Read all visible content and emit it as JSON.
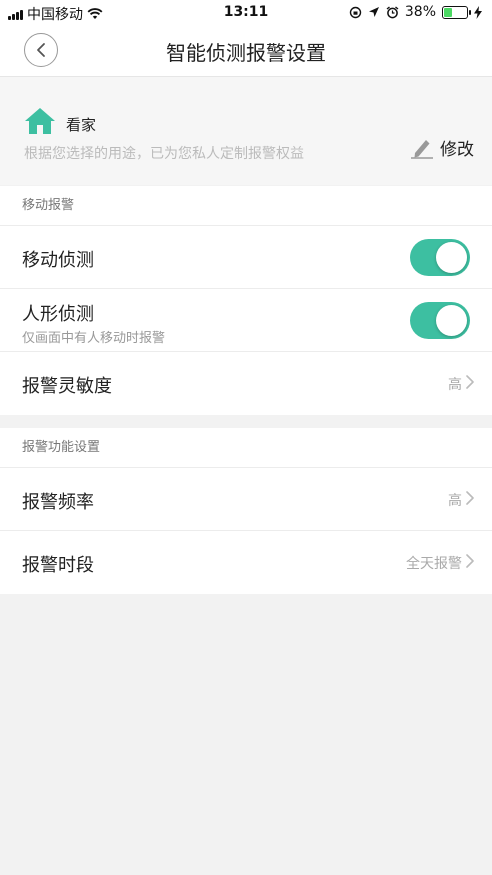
{
  "status_bar": {
    "carrier": "中国移动",
    "time": "13:11",
    "battery_percent": "38%",
    "battery_level": 0.38,
    "icons": [
      "signal-icon",
      "wifi-icon",
      "orientation-lock-icon",
      "location-icon",
      "alarm-icon",
      "battery-icon",
      "charging-icon"
    ]
  },
  "nav": {
    "title": "智能侦测报警设置",
    "back_icon": "back-chevron-icon"
  },
  "profile": {
    "name": "看家",
    "description": "根据您选择的用途，已为您私人定制报警权益",
    "edit_label": "修改",
    "icon": "home-icon",
    "icon_color": "#3dbfa1"
  },
  "motion_section": {
    "header": "移动报警",
    "motion_detection": {
      "label": "移动侦测",
      "enabled": true
    },
    "human_detection": {
      "label": "人形侦测",
      "sub": "仅画面中有人移动时报警",
      "enabled": true
    },
    "sensitivity": {
      "label": "报警灵敏度",
      "value": "高"
    }
  },
  "alarm_section": {
    "header": "报警功能设置",
    "frequency": {
      "label": "报警频率",
      "value": "高"
    },
    "period": {
      "label": "报警时段",
      "value": "全天报警"
    }
  },
  "colors": {
    "accent": "#3dbfa1",
    "background": "#f2f2f2"
  }
}
